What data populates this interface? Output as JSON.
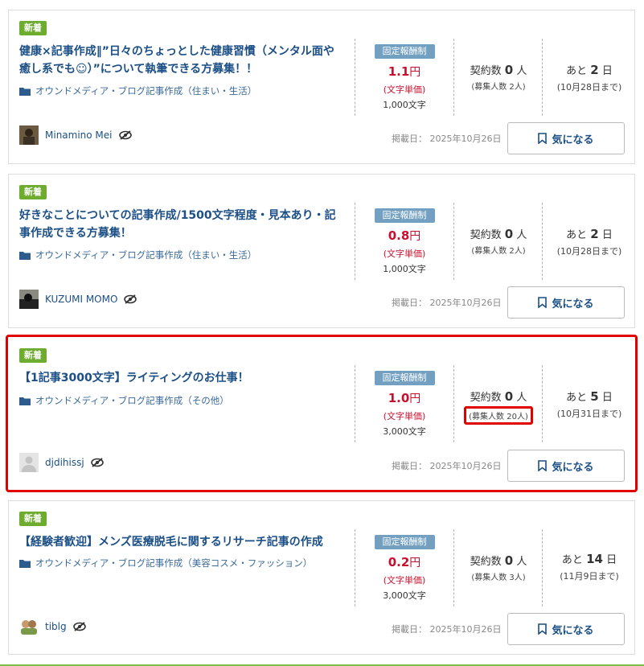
{
  "labels": {
    "pay_type": "固定報酬制",
    "pay_unit_suffix": "円",
    "pay_unit_note": "(文字単価)",
    "contract_prefix": "契約数",
    "contract_suffix": "人",
    "deadline_prefix": "あと",
    "deadline_suffix": "日",
    "posted_prefix": "掲載日：",
    "fav_button": "気になる"
  },
  "jobs": [
    {
      "badge": "新着",
      "title": "健康×記事作成‖”日々のちょっとした健康習慣（メンタル面や癒し系でも☺）”について執筆できる方募集！！",
      "category": "オウンドメディア・ブログ記事作成（住まい・生活）",
      "pay_amount": "1.1",
      "chars": "1,000文字",
      "contracts": "0",
      "recruits": "(募集人数 2人)",
      "days_left": "2",
      "deadline_date": "(10月28日まで)",
      "user": "Minamino Mei",
      "posted_date": "2025年10月26日"
    },
    {
      "badge": "新着",
      "title": "好きなことについての記事作成/1500文字程度・見本あり・記事作成できる方募集！",
      "category": "オウンドメディア・ブログ記事作成（住まい・生活）",
      "pay_amount": "0.8",
      "chars": "1,000文字",
      "contracts": "0",
      "recruits": "(募集人数 2人)",
      "days_left": "2",
      "deadline_date": "(10月28日まで)",
      "user": "KUZUMI MOMO",
      "posted_date": "2025年10月26日"
    },
    {
      "badge": "新着",
      "title": "【1記事3000文字】ライティングのお仕事！",
      "category": "オウンドメディア・ブログ記事作成（その他）",
      "pay_amount": "1.0",
      "chars": "3,000文字",
      "contracts": "0",
      "recruits": "(募集人数 20人)",
      "days_left": "5",
      "deadline_date": "(10月31日まで)",
      "user": "djdihissj",
      "posted_date": "2025年10月26日"
    },
    {
      "badge": "新着",
      "title": "【経験者歓迎】メンズ医療脱毛に関するリサーチ記事の作成",
      "category": "オウンドメディア・ブログ記事作成（美容コスメ・ファッション）",
      "pay_amount": "0.2",
      "chars": "3,000文字",
      "contracts": "0",
      "recruits": "(募集人数 3人)",
      "days_left": "14",
      "deadline_date": "(11月9日まで)",
      "user": "tiblg",
      "posted_date": "2025年10月26日"
    }
  ],
  "colors": {
    "badge_green": "#6eac2f",
    "title_blue": "#1b4f86",
    "price_red": "#c8102e",
    "pay_tag_blue": "#73a0c0",
    "highlight_red": "#e00000"
  }
}
